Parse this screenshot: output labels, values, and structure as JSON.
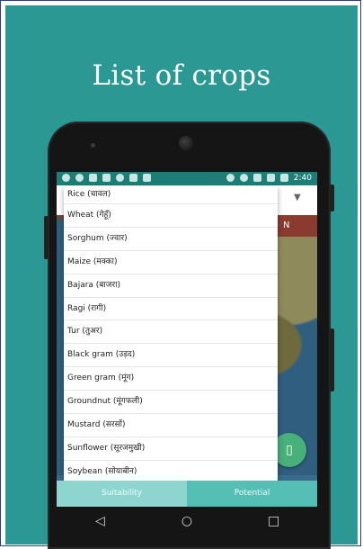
{
  "page": {
    "headline": "List of crops"
  },
  "statusbar": {
    "time": "2:40"
  },
  "map": {
    "header_strip_text": "N"
  },
  "dropdown": {
    "items": [
      "Rice (चावल)",
      "Wheat (गेहूँ)",
      "Sorghum (ज्वार)",
      "Maize (मक्का)",
      "Bajara (बाजरा)",
      "Ragi (रागी)",
      "Tur (तुअर)",
      "Black gram (उड़द)",
      "Green gram (मूंग)",
      "Groundnut (मूंगफली)",
      "Mustard (सरसों)",
      "Sunflower (सूरजमुखी)",
      "Soybean (सोयाबीन)"
    ]
  },
  "tabs": {
    "suitability": "Suitability",
    "potential": "Potential"
  },
  "navbar": {
    "back": "◁",
    "home": "○",
    "recents": "□"
  },
  "colors": {
    "panel": "#2b9893",
    "statusbar": "#1f7d77",
    "tab_active": "#8fd5cf",
    "tab_inactive": "#55bfb6"
  }
}
